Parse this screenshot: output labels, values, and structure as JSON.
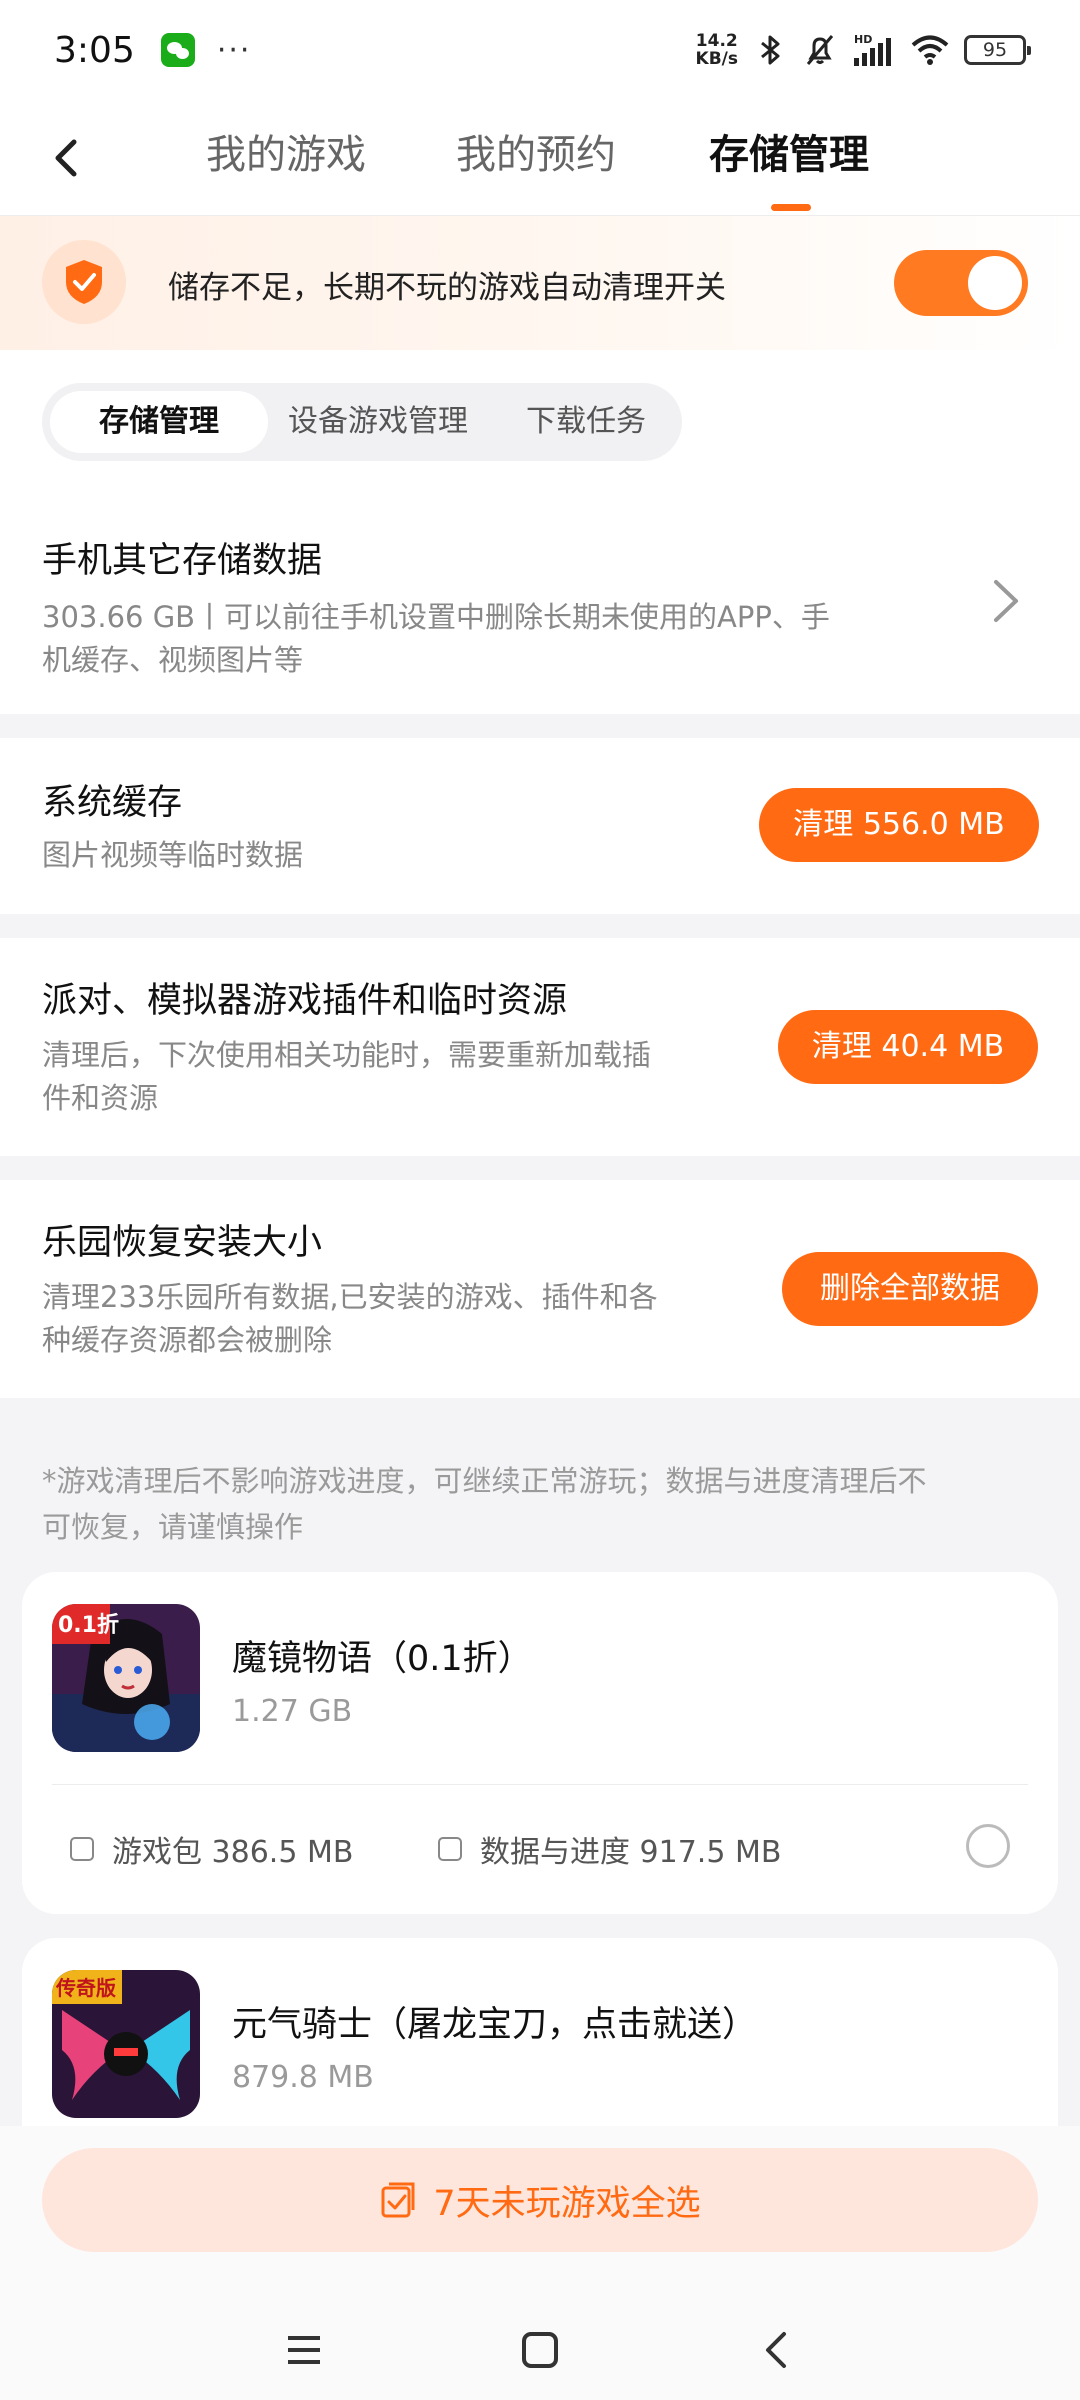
{
  "status_bar": {
    "time": "3:05",
    "dots": "···",
    "net_speed_value": "14.2",
    "net_speed_unit": "KB/s",
    "signal_label": "HD",
    "battery": "95"
  },
  "nav": {
    "tabs": [
      "我的游戏",
      "我的预约",
      "存储管理"
    ],
    "active_tab": "存储管理"
  },
  "banner": {
    "text": "储存不足，长期不玩的游戏自动清理开关",
    "toggle_on": true
  },
  "segments": {
    "items": [
      "存储管理",
      "设备游戏管理",
      "下载任务"
    ],
    "active": "存储管理"
  },
  "other_storage": {
    "title": "手机其它存储数据",
    "desc_line1": "303.66 GB丨可以前往手机设置中删除长期未使用的APP、手",
    "desc_line2": "机缓存、视频图片等"
  },
  "system_cache": {
    "title": "系统缓存",
    "desc": "图片视频等临时数据",
    "button": "清理 556.0 MB"
  },
  "plugins": {
    "title": "派对、模拟器游戏插件和临时资源",
    "desc_line1": "清理后，下次使用相关功能时，需要重新加载插",
    "desc_line2": "件和资源",
    "button": "清理 40.4 MB"
  },
  "restore": {
    "title": "乐园恢复安装大小",
    "desc_line1": "清理233乐园所有数据,已安装的游戏、插件和各",
    "desc_line2": "种缓存资源都会被删除",
    "button": "删除全部数据"
  },
  "note": {
    "line1": "*游戏清理后不影响游戏进度，可继续正常游玩；数据与进度清理后不",
    "line2": "可恢复，请谨慎操作"
  },
  "games": [
    {
      "name": "魔镜物语（0.1折）",
      "size": "1.27 GB",
      "icon_badge": "0.1折",
      "package_label": "游戏包 386.5 MB",
      "data_label": "数据与进度 917.5 MB"
    },
    {
      "name": "元气骑士（屠龙宝刀，点击就送）",
      "size": "879.8 MB",
      "icon_badge": "传奇版"
    }
  ],
  "bottom": {
    "select_button": "7天未玩游戏全选"
  },
  "colors": {
    "accent": "#ff6a13",
    "toggle": "#ff7a21",
    "select_bg": "#ffe6dc"
  }
}
